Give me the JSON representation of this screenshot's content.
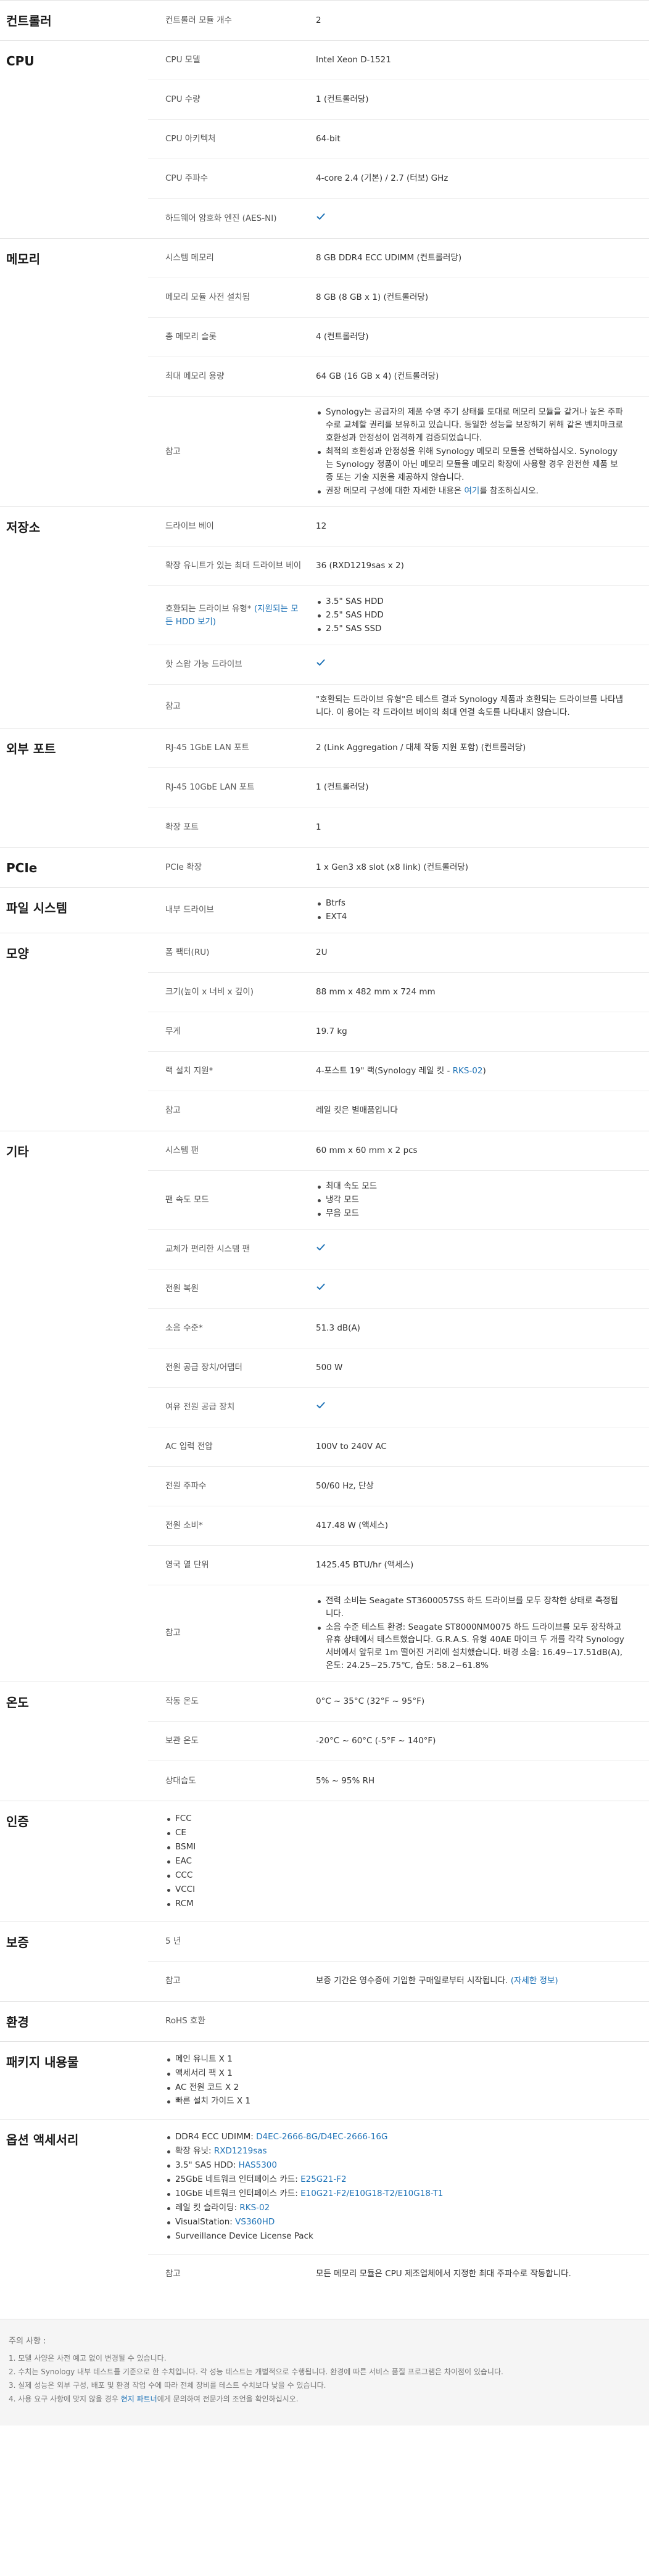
{
  "colors": {
    "accent": "#1f73b7",
    "text": "#333333",
    "divider": "#e3e3e3",
    "footer_bg": "#f5f5f5"
  },
  "sections": [
    {
      "id": "controller",
      "title": "컨트롤러",
      "rows": [
        {
          "label": "컨트롤러 모듈 개수",
          "value": "2"
        }
      ]
    },
    {
      "id": "cpu",
      "title": "CPU",
      "rows": [
        {
          "label": "CPU 모델",
          "value": "Intel Xeon D-1521"
        },
        {
          "label": "CPU 수량",
          "value": "1 (컨트롤러당)"
        },
        {
          "label": "CPU 아키텍처",
          "value": "64-bit"
        },
        {
          "label": "CPU 주파수",
          "value": "4-core 2.4 (기본) / 2.7 (터보) GHz"
        },
        {
          "label": "하드웨어 암호화 엔진 (AES-NI)",
          "check": true
        }
      ]
    },
    {
      "id": "memory",
      "title": "메모리",
      "rows": [
        {
          "label": "시스템 메모리",
          "value": "8 GB DDR4 ECC UDIMM (컨트롤러당)"
        },
        {
          "label": "메모리 모듈 사전 설치됨",
          "value": "8 GB (8 GB x 1) (컨트롤러당)"
        },
        {
          "label": "총 메모리 슬롯",
          "value": "4 (컨트롤러당)"
        },
        {
          "label": "최대 메모리 용량",
          "value": "64 GB (16 GB x 4) (컨트롤러당)"
        },
        {
          "label": "참고",
          "list": [
            "Synology는 공급자의 제품 수명 주기 상태를 토대로 메모리 모듈을 같거나 높은 주파수로 교체할 권리를 보유하고 있습니다. 동일한 성능을 보장하기 위해 같은 벤치마크로 호환성과 안정성이 엄격하게 검증되었습니다.",
            "최적의 호환성과 안정성을 위해 Synology 메모리 모듈을 선택하십시오. Synology는 Synology 정품이 아닌 메모리 모듈을 메모리 확장에 사용할 경우 완전한 제품 보증 또는 기술 지원을 제공하지 않습니다.",
            {
              "pre": "권장 메모리 구성에 대한 자세한 내용은 ",
              "link": "여기",
              "post": "를 참조하십시오."
            }
          ]
        }
      ]
    },
    {
      "id": "storage",
      "title": "저장소",
      "rows": [
        {
          "label": "드라이브 베이",
          "value": "12"
        },
        {
          "label": "확장 유니트가 있는 최대 드라이브 베이",
          "value": "36 (RXD1219sas x 2)"
        },
        {
          "label": "호환되는 드라이브 유형*",
          "label_link": "(지원되는 모든 HDD 보기)",
          "list": [
            "3.5\" SAS HDD",
            "2.5\" SAS HDD",
            "2.5\" SAS SSD"
          ]
        },
        {
          "label": "핫 스왑 가능 드라이브",
          "check": true
        },
        {
          "label": "참고",
          "value": "\"호환되는 드라이브 유형\"은 테스트 결과 Synology 제품과 호환되는 드라이브를 나타냅니다. 이 용어는 각 드라이브 베이의 최대 연결 속도를 나타내지 않습니다."
        }
      ]
    },
    {
      "id": "ports",
      "title": "외부 포트",
      "rows": [
        {
          "label": "RJ-45 1GbE LAN 포트",
          "value": "2 (Link Aggregation / 대체 작동 지원 포함) (컨트롤러당)"
        },
        {
          "label": "RJ-45 10GbE LAN 포트",
          "value": "1 (컨트롤러당)"
        },
        {
          "label": "확장 포트",
          "value": "1"
        }
      ]
    },
    {
      "id": "pcie",
      "title": "PCIe",
      "rows": [
        {
          "label": "PCIe 확장",
          "value": "1 x Gen3 x8 slot (x8 link) (컨트롤러당)"
        }
      ]
    },
    {
      "id": "filesystem",
      "title": "파일 시스템",
      "rows": [
        {
          "label": "내부 드라이브",
          "list": [
            "Btrfs",
            "EXT4"
          ]
        }
      ]
    },
    {
      "id": "appearance",
      "title": "모양",
      "rows": [
        {
          "label": "폼 팩터(RU)",
          "value": "2U"
        },
        {
          "label": "크기(높이 x 너비 x 깊이)",
          "value": "88 mm x 482 mm x 724 mm"
        },
        {
          "label": "무게",
          "value": "19.7 kg"
        },
        {
          "label": "랙 설치 지원*",
          "value_pre": "4-포스트 19\" 랙(Synology 레일 킷 - ",
          "value_link": "RKS-02",
          "value_post": ")"
        },
        {
          "label": "참고",
          "value": "레일 킷은 별매품입니다"
        }
      ]
    },
    {
      "id": "others",
      "title": "기타",
      "rows": [
        {
          "label": "시스템 팬",
          "value": "60 mm x 60 mm x 2 pcs"
        },
        {
          "label": "팬 속도 모드",
          "list": [
            "최대 속도 모드",
            "냉각 모드",
            "무음 모드"
          ]
        },
        {
          "label": "교체가 편리한 시스템 팬",
          "check": true
        },
        {
          "label": "전원 복원",
          "check": true
        },
        {
          "label": "소음 수준*",
          "value": "51.3 dB(A)"
        },
        {
          "label": "전원 공급 장치/어댑터",
          "value": "500 W"
        },
        {
          "label": "여유 전원 공급 장치",
          "check": true
        },
        {
          "label": "AC 입력 전압",
          "value": "100V to 240V AC"
        },
        {
          "label": "전원 주파수",
          "value": "50/60 Hz, 단상"
        },
        {
          "label": "전원 소비*",
          "value": "417.48 W (액세스)"
        },
        {
          "label": "영국 열 단위",
          "value": "1425.45 BTU/hr (액세스)"
        },
        {
          "label": "참고",
          "list": [
            "전력 소비는 Seagate ST3600057SS 하드 드라이브를 모두 장착한 상태로 측정됩니다.",
            "소음 수준 테스트 환경: Seagate ST8000NM0075 하드 드라이브를 모두 장착하고 유휴 상태에서 테스트했습니다. G.R.A.S. 유형 40AE 마이크 두 개를 각각 Synology 서버에서 앞뒤로 1m 떨어진 거리에 설치했습니다. 배경 소음: 16.49~17.51dB(A), 온도: 24.25~25.75℃, 습도: 58.2~61.8%"
          ]
        }
      ]
    },
    {
      "id": "temperature",
      "title": "온도",
      "rows": [
        {
          "label": "작동 온도",
          "value": "0°C ~ 35°C (32°F ~ 95°F)"
        },
        {
          "label": "보관 온도",
          "value": "-20°C ~ 60°C (-5°F ~ 140°F)"
        },
        {
          "label": "상대습도",
          "value": "5% ~ 95% RH"
        }
      ]
    }
  ],
  "certification": {
    "title": "인증",
    "items": [
      "FCC",
      "CE",
      "BSMI",
      "EAC",
      "CCC",
      "VCCI",
      "RCM"
    ]
  },
  "warranty": {
    "title": "보증",
    "rows": [
      {
        "label": "5 년",
        "value": ""
      },
      {
        "label": "참고",
        "value_pre": "보증 기간은 영수증에 기입한 구매일로부터 시작됩니다. ",
        "value_link": "(자세한 정보)",
        "value_post": ""
      }
    ]
  },
  "environment": {
    "title": "환경",
    "rows": [
      {
        "label": "RoHS 호환",
        "value": ""
      }
    ]
  },
  "package": {
    "title": "패키지 내용물",
    "items": [
      "메인 유니트 X 1",
      "액세서리 팩 X 1",
      "AC 전원 코드 X 2",
      "빠른 설치 가이드 X 1"
    ]
  },
  "accessories": {
    "title": "옵션 액세서리",
    "items": [
      {
        "pre": "DDR4 ECC UDIMM: ",
        "link": "D4EC-2666-8G/D4EC-2666-16G"
      },
      {
        "pre": "확장 유닛: ",
        "link": "RXD1219sas"
      },
      {
        "pre": "3.5\" SAS HDD: ",
        "link": "HAS5300"
      },
      {
        "pre": "25GbE 네트워크 인터페이스 카드: ",
        "link": "E25G21-F2"
      },
      {
        "pre": "10GbE 네트워크 인터페이스 카드: ",
        "link": "E10G21-F2/E10G18-T2/E10G18-T1"
      },
      {
        "pre": "레일 킷 슬라이딩: ",
        "link": "RKS-02"
      },
      {
        "pre": "VisualStation: ",
        "link": "VS360HD"
      },
      {
        "pre": "Surveillance Device License Pack",
        "link": ""
      }
    ],
    "note_label": "참고",
    "note_value": "모든 메모리 모듈은 CPU 제조업체에서 지정한 최대 주파수로 작동합니다."
  },
  "footnotes": {
    "title": "주의 사항 :",
    "items": [
      "1. 모델 사양은 사전 예고 없이 변경될 수 있습니다.",
      "2. 수치는 Synology 내부 테스트를 기준으로 한 수치입니다. 각 성능 테스트는 개별적으로 수행됩니다. 환경에 따른 서비스 품질 프로그램은 차이점이 있습니다.",
      "3. 실제 성능은 외부 구성, 배포 및 환경 작업 수에 따라 전체 장비를 테스트 수치보다 낮을 수 있습니다.",
      {
        "pre": "4. 사용 요구 사항에 맞지 않을 경우 ",
        "link": "현지 파트너",
        "post": "에게 문의하여 전문가의 조언을 확인하십시오."
      }
    ]
  }
}
